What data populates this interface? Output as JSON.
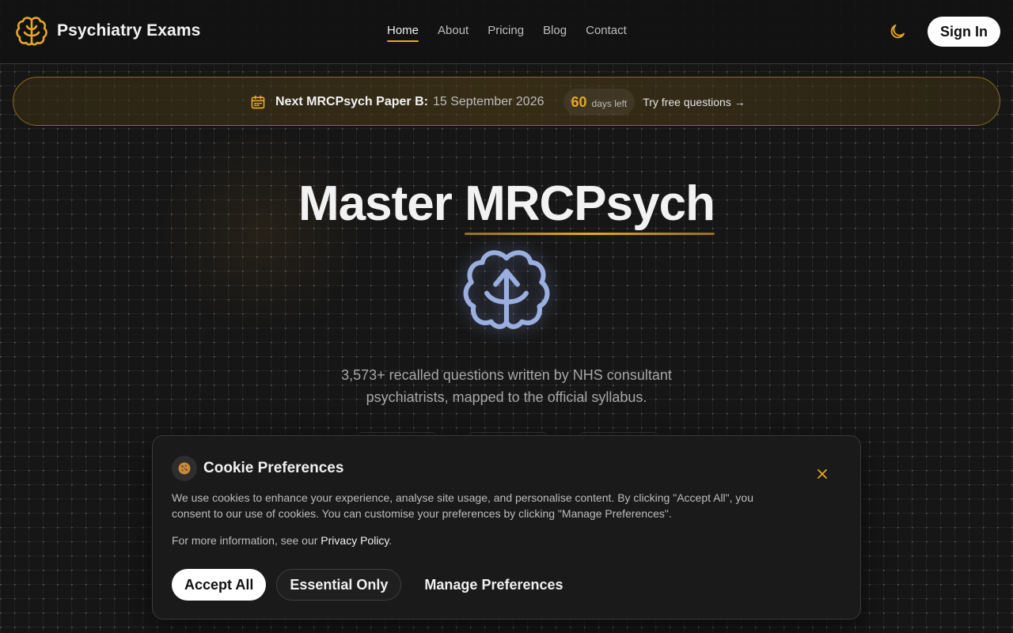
{
  "header": {
    "brand": "Psychiatry Exams",
    "nav": [
      "Home",
      "About",
      "Pricing",
      "Blog",
      "Contact"
    ],
    "active_nav": "Home",
    "sign_in": "Sign In"
  },
  "banner": {
    "title": "Next MRCPsych Paper B:",
    "date": "15 September 2026",
    "days_count": "60",
    "days_label": "days left",
    "cta": "Try free questions →"
  },
  "hero": {
    "title_plain": "Master",
    "title_accent": "MRCPsych",
    "subtitle": "3,573+ recalled questions written by NHS consultant psychiatrists, mapped to the official syllabus."
  },
  "cookie": {
    "title": "Cookie Preferences",
    "body": "We use cookies to enhance your experience, analyse site usage, and personalise content. By clicking \"Accept All\", you consent to our use of cookies. You can customise your preferences by clicking \"Manage Preferences\".",
    "more_prefix": "For more information, see our",
    "privacy_link": "Privacy Policy",
    "more_suffix": ".",
    "accept_all": "Accept All",
    "essential_only": "Essential Only",
    "manage": "Manage Preferences"
  },
  "colors": {
    "accent": "#e6a822",
    "brain_hero": "#9aaee0",
    "background": "#161616"
  },
  "icons": [
    "brain-logo-icon",
    "moon-icon",
    "calendar-icon",
    "brain-hero-icon",
    "cookie-icon",
    "close-icon"
  ]
}
